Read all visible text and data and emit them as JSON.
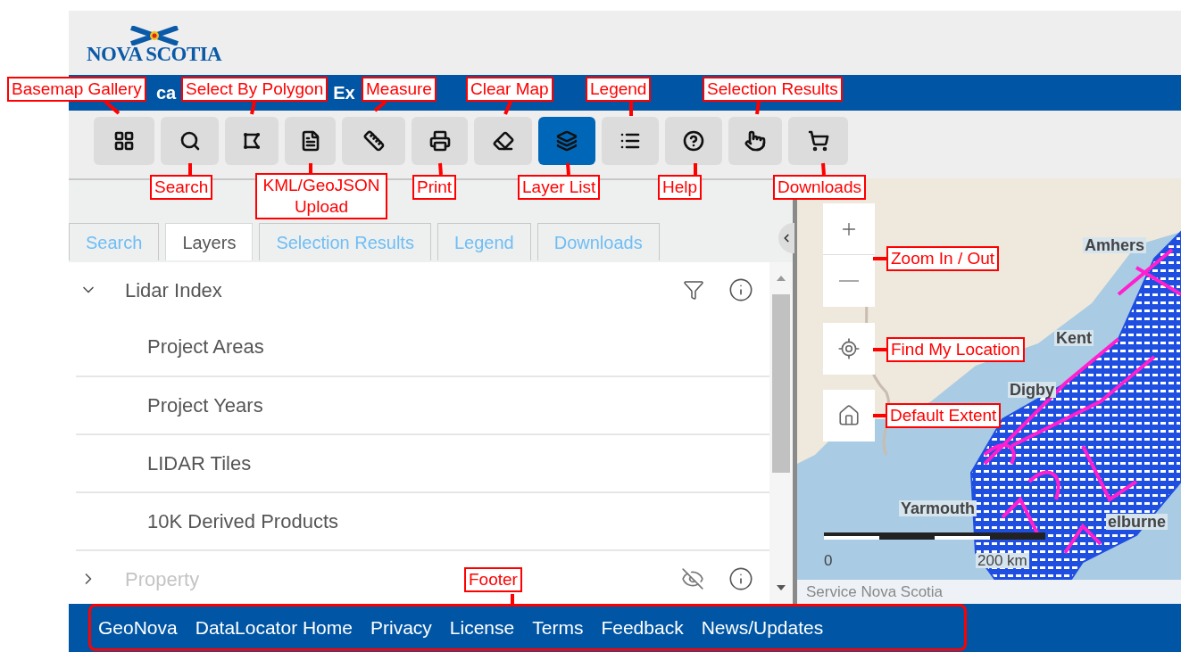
{
  "logo": {
    "text": "NOVA SCOTIA"
  },
  "title_bar": {
    "visible_fragments": [
      "ca",
      "Ex"
    ]
  },
  "toolbar": [
    {
      "kind": "basemap",
      "selected": false
    },
    {
      "kind": "search",
      "selected": false
    },
    {
      "kind": "polygon",
      "selected": false
    },
    {
      "kind": "file",
      "selected": false
    },
    {
      "kind": "ruler",
      "selected": false
    },
    {
      "kind": "print",
      "selected": false
    },
    {
      "kind": "eraser",
      "selected": false
    },
    {
      "kind": "layers",
      "selected": true
    },
    {
      "kind": "list",
      "selected": false
    },
    {
      "kind": "help",
      "selected": false
    },
    {
      "kind": "hand",
      "selected": false
    },
    {
      "kind": "cart",
      "selected": false
    }
  ],
  "panel_tabs": [
    {
      "label": "Search",
      "selected": false
    },
    {
      "label": "Layers",
      "selected": true
    },
    {
      "label": "Selection Results",
      "selected": false
    },
    {
      "label": "Legend",
      "selected": false
    },
    {
      "label": "Downloads",
      "selected": false
    }
  ],
  "layers": [
    {
      "label": "Lidar Index",
      "expanded": true,
      "visible": true,
      "children": [
        {
          "label": "Project Areas"
        },
        {
          "label": "Project Years"
        },
        {
          "label": "LIDAR Tiles"
        },
        {
          "label": "10K Derived Products"
        }
      ]
    },
    {
      "label": "Property",
      "expanded": false,
      "visible": false
    }
  ],
  "map": {
    "place_labels": [
      "Amhers",
      "Kent",
      "Digby",
      "Yarmouth",
      "elburne"
    ],
    "scale": {
      "start": "0",
      "end": "200 km"
    },
    "attribution": "Service Nova Scotia"
  },
  "footer_links": [
    "GeoNova",
    "DataLocator Home",
    "Privacy",
    "License",
    "Terms",
    "Feedback",
    "News/Updates"
  ],
  "callouts": [
    {
      "label": "Basemap Gallery"
    },
    {
      "label": "Select By Polygon"
    },
    {
      "label": "Measure"
    },
    {
      "label": "Clear Map"
    },
    {
      "label": "Legend"
    },
    {
      "label": "Selection Results"
    },
    {
      "label": "Search"
    },
    {
      "label": "KML/GeoJSON Upload"
    },
    {
      "label": "Print"
    },
    {
      "label": "Layer List"
    },
    {
      "label": "Help"
    },
    {
      "label": "Downloads"
    },
    {
      "label": "Zoom In / Out"
    },
    {
      "label": "Find My Location"
    },
    {
      "label": "Default Extent"
    },
    {
      "label": "Footer"
    }
  ]
}
